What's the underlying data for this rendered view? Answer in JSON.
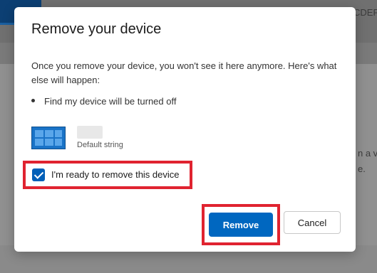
{
  "background": {
    "top_right_text": "CDEF",
    "right_text_1": "n a vi",
    "right_text_2": "e."
  },
  "dialog": {
    "title": "Remove your device",
    "description": "Once you remove your device, you won't see it here anymore. Here's what else will happen:",
    "bullets": [
      "Find my device will be turned off"
    ],
    "device": {
      "subtitle": "Default string"
    },
    "checkbox": {
      "label": "I'm ready to remove this device",
      "checked": true
    },
    "buttons": {
      "remove": "Remove",
      "cancel": "Cancel"
    }
  },
  "colors": {
    "accent": "#0067c0",
    "highlight": "#e02330"
  }
}
